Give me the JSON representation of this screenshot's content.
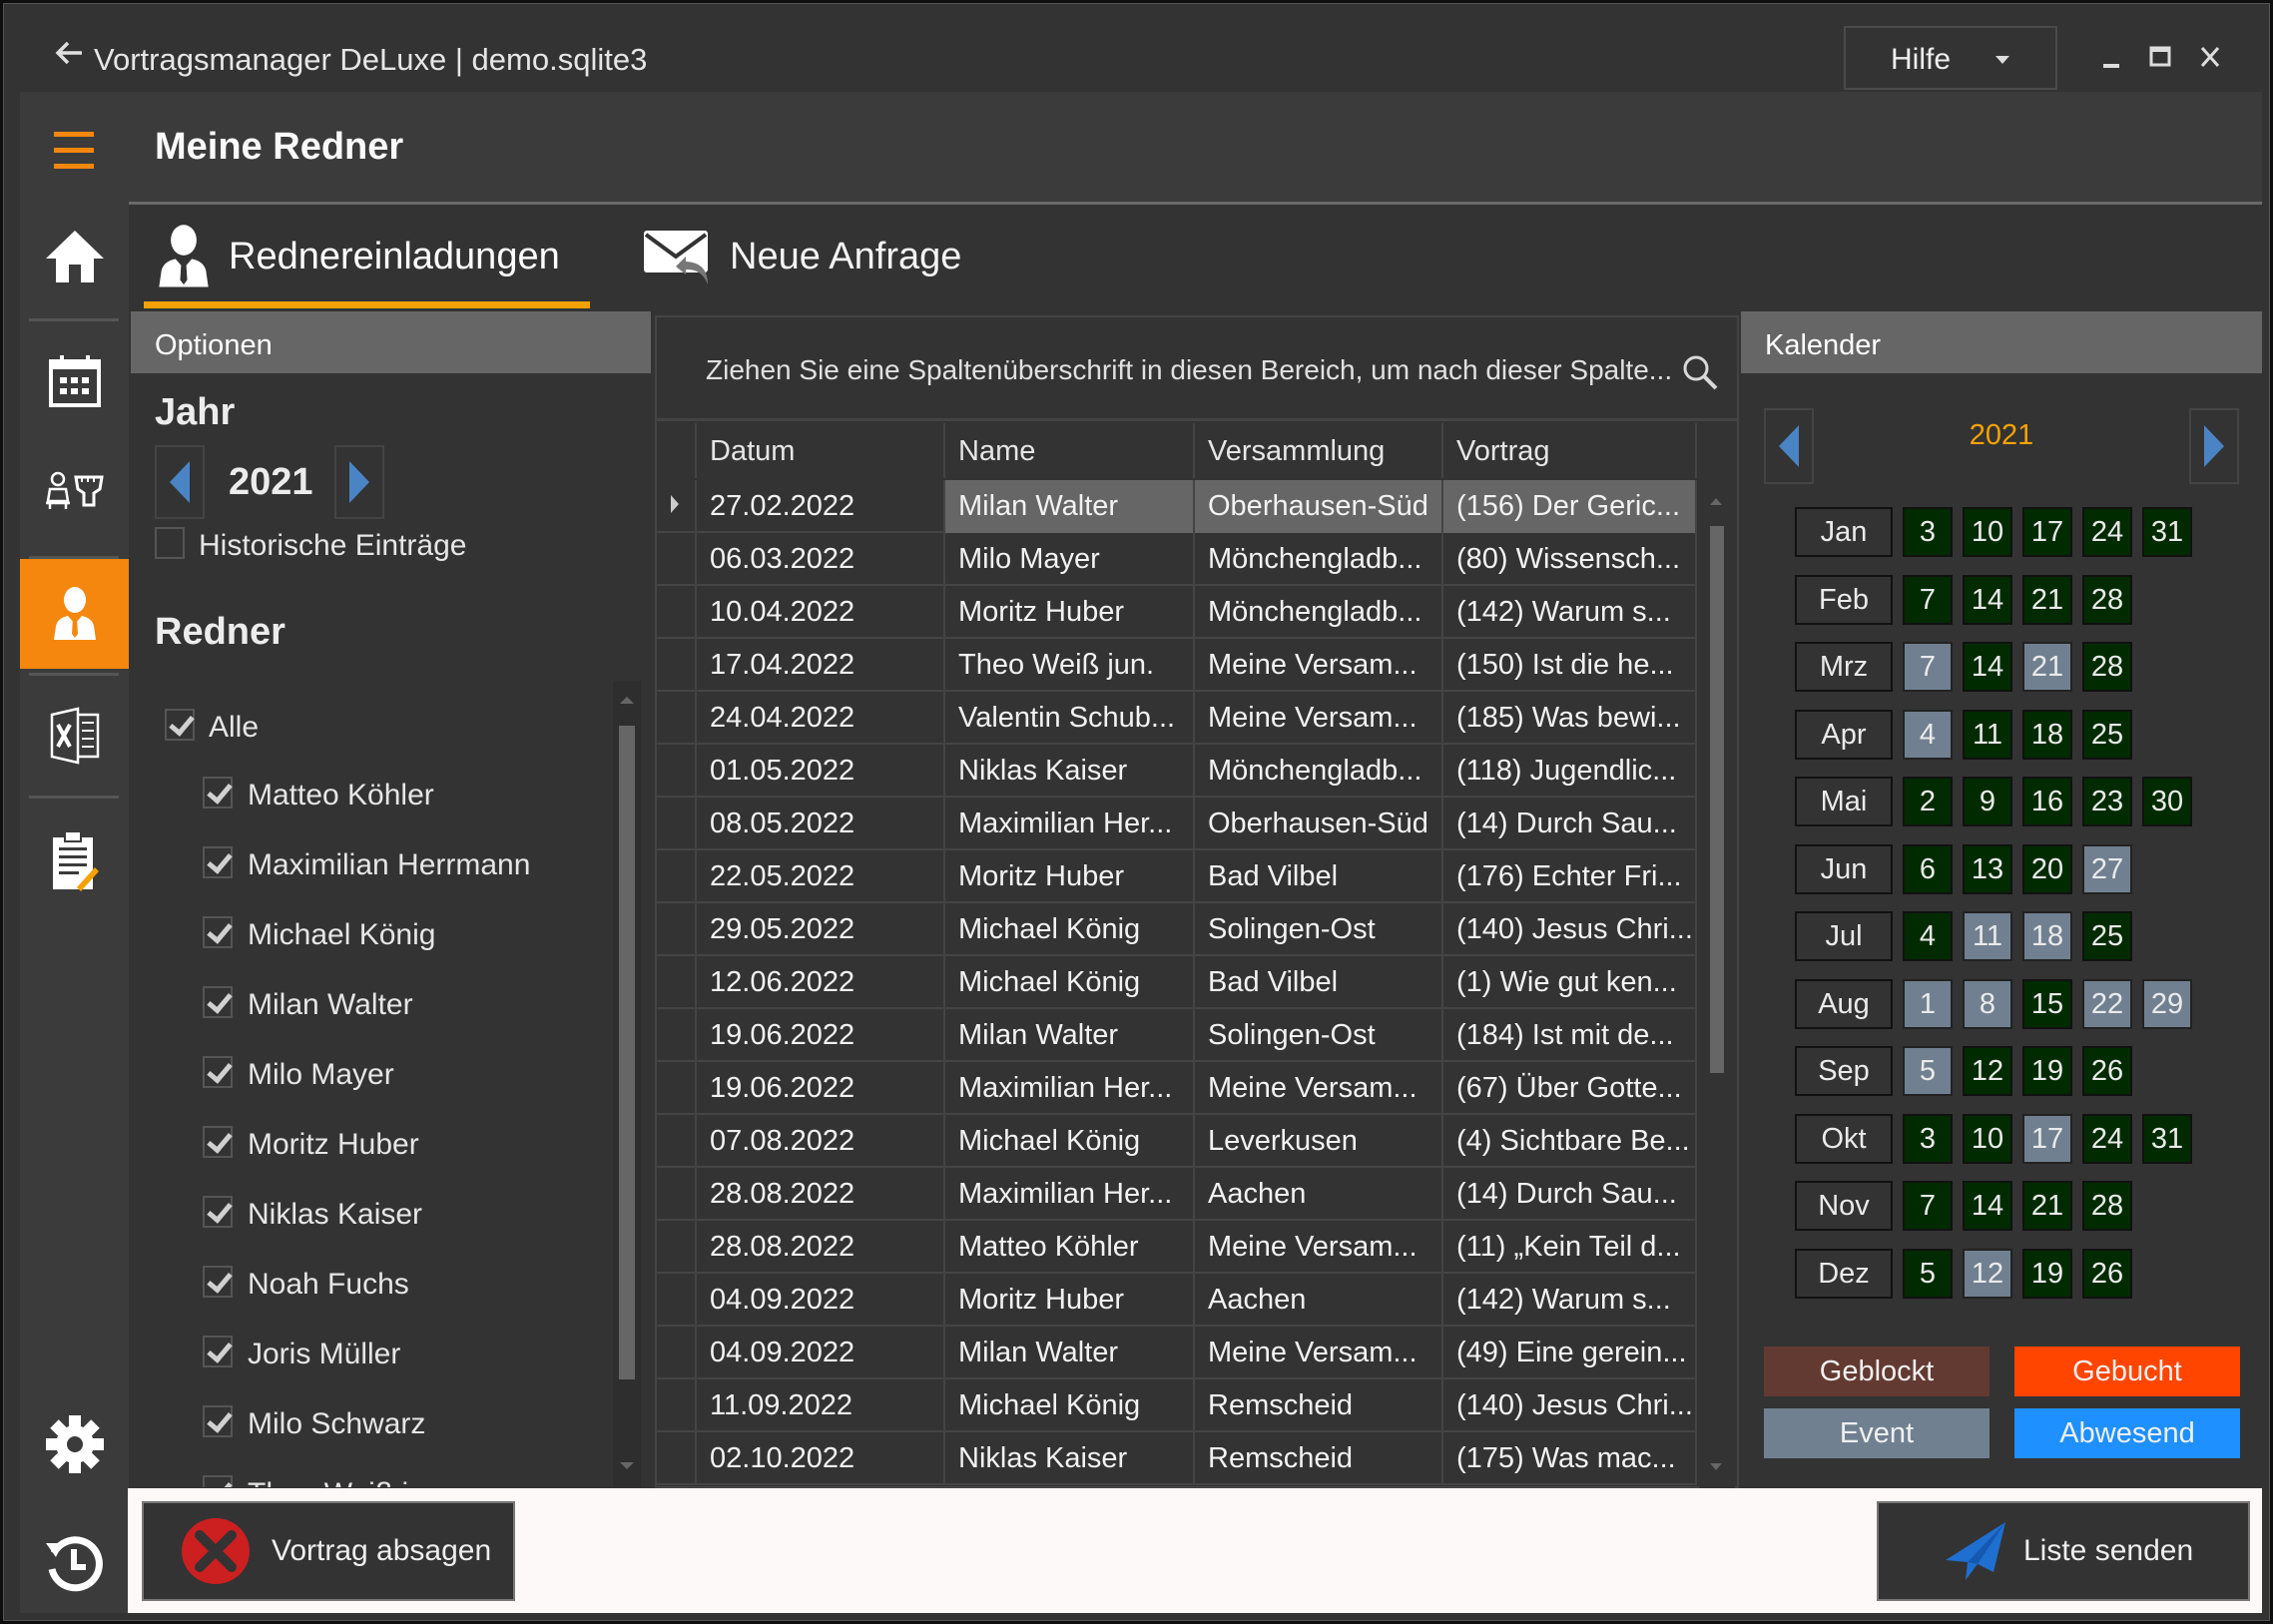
{
  "window": {
    "title": "Vortragsmanager DeLuxe | demo.sqlite3",
    "help_label": "Hilfe",
    "controls": [
      "minimize",
      "maximize",
      "close"
    ]
  },
  "header": {
    "title": "Meine Redner"
  },
  "sidebar": {
    "items": [
      {
        "icon": "home-icon",
        "active": false
      },
      {
        "icon": "calendar-icon",
        "active": false
      },
      {
        "icon": "speaker-podium-icon",
        "active": false
      },
      {
        "icon": "speaker-person-icon",
        "active": true
      },
      {
        "icon": "excel-icon",
        "active": false
      },
      {
        "icon": "clipboard-edit-icon",
        "active": false
      },
      {
        "icon": "gear-icon",
        "active": false
      },
      {
        "icon": "history-icon",
        "active": false
      }
    ]
  },
  "tabs": [
    {
      "label": "Rednereinladungen",
      "icon": "speaker-person-icon",
      "active": true
    },
    {
      "label": "Neue Anfrage",
      "icon": "mail-reply-icon",
      "active": false
    }
  ],
  "options": {
    "header": "Optionen",
    "year_label": "Jahr",
    "year": "2021",
    "historic_label": "Historische Einträge",
    "historic_checked": false,
    "speakers_label": "Redner",
    "all_label": "Alle",
    "all_checked": true,
    "speakers": [
      {
        "name": "Matteo Köhler",
        "checked": true
      },
      {
        "name": "Maximilian Herrmann",
        "checked": true
      },
      {
        "name": "Michael König",
        "checked": true
      },
      {
        "name": "Milan Walter",
        "checked": true
      },
      {
        "name": "Milo Mayer",
        "checked": true
      },
      {
        "name": "Moritz Huber",
        "checked": true
      },
      {
        "name": "Niklas Kaiser",
        "checked": true
      },
      {
        "name": "Noah Fuchs",
        "checked": true
      },
      {
        "name": "Joris Müller",
        "checked": true
      },
      {
        "name": "Milo Schwarz",
        "checked": true
      },
      {
        "name": "Theo Weiß jun.",
        "checked": true
      }
    ]
  },
  "grid": {
    "group_hint": "Ziehen Sie eine Spaltenüberschrift in diesen Bereich, um nach dieser Spalte...",
    "columns": [
      "Datum",
      "Name",
      "Versammlung",
      "Vortrag"
    ],
    "selected_row": 0,
    "rows": [
      [
        "27.02.2022",
        "Milan Walter",
        "Oberhausen-Süd",
        "(156) Der Geric..."
      ],
      [
        "06.03.2022",
        "Milo Mayer",
        "Mönchengladb...",
        "(80) Wissensch..."
      ],
      [
        "10.04.2022",
        "Moritz Huber",
        "Mönchengladb...",
        "(142) Warum s..."
      ],
      [
        "17.04.2022",
        "Theo Weiß jun.",
        "Meine Versam...",
        "(150) Ist die he..."
      ],
      [
        "24.04.2022",
        "Valentin Schub...",
        "Meine Versam...",
        "(185) Was bewi..."
      ],
      [
        "01.05.2022",
        "Niklas Kaiser",
        "Mönchengladb...",
        "(118) Jugendlic..."
      ],
      [
        "08.05.2022",
        "Maximilian Her...",
        "Oberhausen-Süd",
        "(14) Durch Sau..."
      ],
      [
        "22.05.2022",
        "Moritz Huber",
        "Bad Vilbel",
        "(176) Echter Fri..."
      ],
      [
        "29.05.2022",
        "Michael König",
        "Solingen-Ost",
        "(140) Jesus Chri..."
      ],
      [
        "12.06.2022",
        "Michael König",
        "Bad Vilbel",
        "(1) Wie gut ken..."
      ],
      [
        "19.06.2022",
        "Milan Walter",
        "Solingen-Ost",
        "(184) Ist mit de..."
      ],
      [
        "19.06.2022",
        "Maximilian Her...",
        "Meine Versam...",
        "(67) Über Gotte..."
      ],
      [
        "07.08.2022",
        "Michael König",
        "Leverkusen",
        "(4) Sichtbare Be..."
      ],
      [
        "28.08.2022",
        "Maximilian Her...",
        "Aachen",
        "(14) Durch Sau..."
      ],
      [
        "28.08.2022",
        "Matteo Köhler",
        "Meine Versam...",
        "(11) „Kein Teil d..."
      ],
      [
        "04.09.2022",
        "Moritz Huber",
        "Aachen",
        "(142) Warum s..."
      ],
      [
        "04.09.2022",
        "Milan Walter",
        "Meine Versam...",
        "(49) Eine gerein..."
      ],
      [
        "11.09.2022",
        "Michael König",
        "Remscheid",
        "(140) Jesus Chri..."
      ],
      [
        "02.10.2022",
        "Niklas Kaiser",
        "Remscheid",
        "(175) Was mac..."
      ]
    ]
  },
  "calendar": {
    "header": "Kalender",
    "year": "2021",
    "status_colors": {
      "free": "#002b00",
      "event": "#708090",
      "geblockt": "#633a32",
      "gebucht": "#ff4500",
      "abwesend": "#1e90ff"
    },
    "months": [
      {
        "label": "Jan",
        "days": [
          {
            "d": "3",
            "s": "free"
          },
          {
            "d": "10",
            "s": "free"
          },
          {
            "d": "17",
            "s": "free"
          },
          {
            "d": "24",
            "s": "free"
          },
          {
            "d": "31",
            "s": "free"
          }
        ]
      },
      {
        "label": "Feb",
        "days": [
          {
            "d": "7",
            "s": "free"
          },
          {
            "d": "14",
            "s": "free"
          },
          {
            "d": "21",
            "s": "free"
          },
          {
            "d": "28",
            "s": "free"
          }
        ]
      },
      {
        "label": "Mrz",
        "days": [
          {
            "d": "7",
            "s": "event"
          },
          {
            "d": "14",
            "s": "free"
          },
          {
            "d": "21",
            "s": "event"
          },
          {
            "d": "28",
            "s": "free"
          }
        ]
      },
      {
        "label": "Apr",
        "days": [
          {
            "d": "4",
            "s": "event"
          },
          {
            "d": "11",
            "s": "free"
          },
          {
            "d": "18",
            "s": "free"
          },
          {
            "d": "25",
            "s": "free"
          }
        ]
      },
      {
        "label": "Mai",
        "days": [
          {
            "d": "2",
            "s": "free"
          },
          {
            "d": "9",
            "s": "free"
          },
          {
            "d": "16",
            "s": "free"
          },
          {
            "d": "23",
            "s": "free"
          },
          {
            "d": "30",
            "s": "free"
          }
        ]
      },
      {
        "label": "Jun",
        "days": [
          {
            "d": "6",
            "s": "free"
          },
          {
            "d": "13",
            "s": "free"
          },
          {
            "d": "20",
            "s": "free"
          },
          {
            "d": "27",
            "s": "event"
          }
        ]
      },
      {
        "label": "Jul",
        "days": [
          {
            "d": "4",
            "s": "free"
          },
          {
            "d": "11",
            "s": "event"
          },
          {
            "d": "18",
            "s": "event"
          },
          {
            "d": "25",
            "s": "free"
          }
        ]
      },
      {
        "label": "Aug",
        "days": [
          {
            "d": "1",
            "s": "event"
          },
          {
            "d": "8",
            "s": "event"
          },
          {
            "d": "15",
            "s": "free"
          },
          {
            "d": "22",
            "s": "event"
          },
          {
            "d": "29",
            "s": "event"
          }
        ]
      },
      {
        "label": "Sep",
        "days": [
          {
            "d": "5",
            "s": "event"
          },
          {
            "d": "12",
            "s": "free"
          },
          {
            "d": "19",
            "s": "free"
          },
          {
            "d": "26",
            "s": "free"
          }
        ]
      },
      {
        "label": "Okt",
        "days": [
          {
            "d": "3",
            "s": "free"
          },
          {
            "d": "10",
            "s": "free"
          },
          {
            "d": "17",
            "s": "event"
          },
          {
            "d": "24",
            "s": "free"
          },
          {
            "d": "31",
            "s": "free"
          }
        ]
      },
      {
        "label": "Nov",
        "days": [
          {
            "d": "7",
            "s": "free"
          },
          {
            "d": "14",
            "s": "free"
          },
          {
            "d": "21",
            "s": "free"
          },
          {
            "d": "28",
            "s": "free"
          }
        ]
      },
      {
        "label": "Dez",
        "days": [
          {
            "d": "5",
            "s": "free"
          },
          {
            "d": "12",
            "s": "event"
          },
          {
            "d": "19",
            "s": "free"
          },
          {
            "d": "26",
            "s": "free"
          }
        ]
      }
    ],
    "legend": [
      {
        "label": "Geblockt",
        "status": "geblockt"
      },
      {
        "label": "Gebucht",
        "status": "gebucht"
      },
      {
        "label": "Event",
        "status": "event"
      },
      {
        "label": "Abwesend",
        "status": "abwesend"
      }
    ]
  },
  "actions": {
    "cancel_label": "Vortrag absagen",
    "send_label": "Liste senden"
  }
}
